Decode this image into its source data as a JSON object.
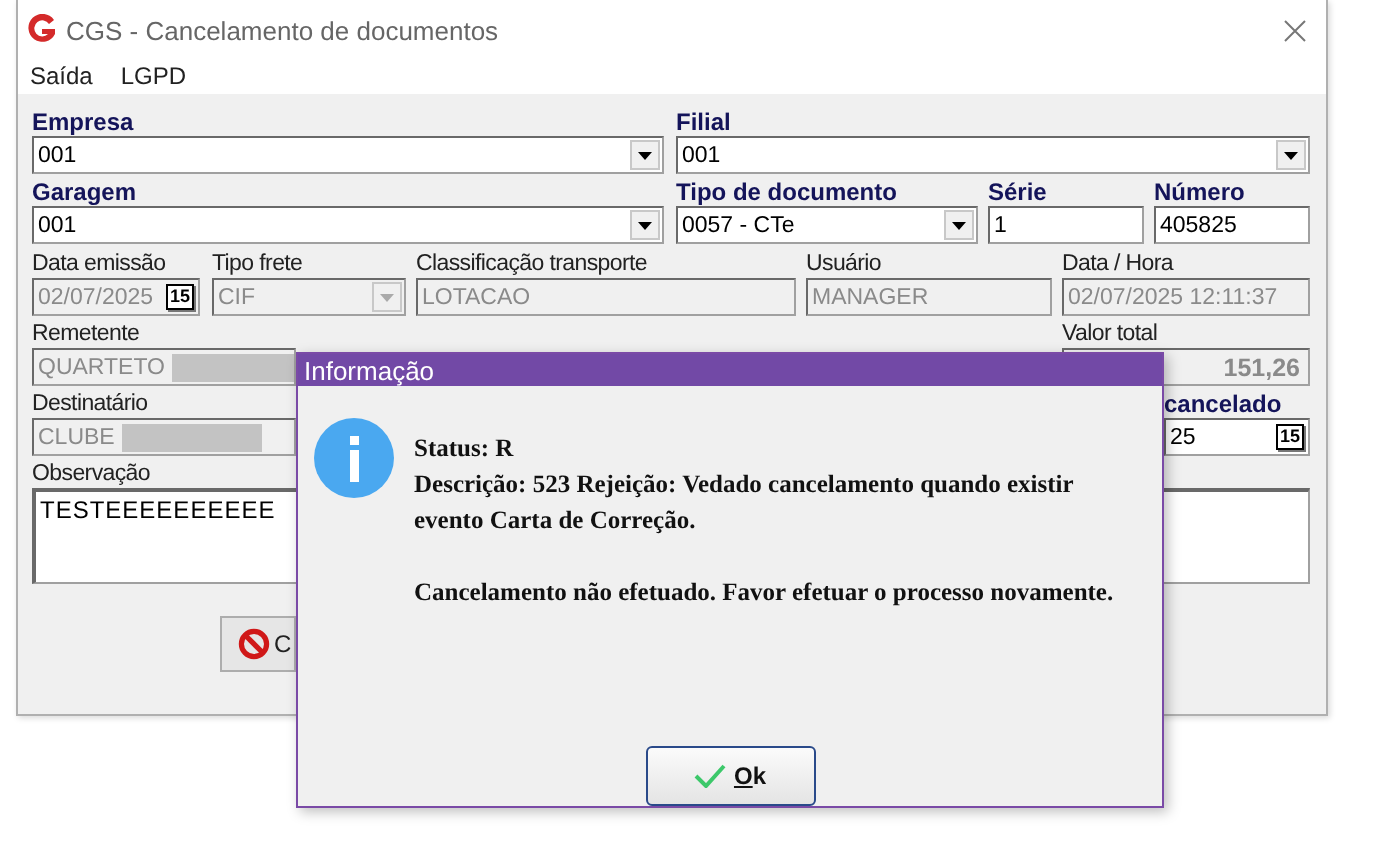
{
  "window": {
    "title": "CGS - Cancelamento de documentos"
  },
  "menu": [
    {
      "label": "Saída"
    },
    {
      "label": "LGPD"
    }
  ],
  "rows": [
    [
      {
        "label": "Empresa",
        "value": "001",
        "kind": "combo",
        "required": true,
        "disabled": false
      },
      {
        "label": "Filial",
        "value": "001",
        "kind": "combo",
        "required": true,
        "disabled": false
      }
    ],
    [
      {
        "label": "Garagem",
        "value": "001",
        "kind": "combo",
        "required": true,
        "disabled": false
      },
      {
        "label": "Tipo de documento",
        "value": "0057 - CTe",
        "kind": "combo",
        "required": true,
        "disabled": false
      },
      {
        "label": "Série",
        "value": "1",
        "kind": "text",
        "required": true,
        "disabled": false
      },
      {
        "label": "Número",
        "value": "405825",
        "kind": "text",
        "required": true,
        "disabled": false
      }
    ],
    [
      {
        "label": "Data emissão",
        "value": "02/07/2025",
        "kind": "date",
        "picker": "15",
        "required": false,
        "disabled": true
      },
      {
        "label": "Tipo frete",
        "value": "CIF",
        "kind": "combo",
        "required": false,
        "disabled": true
      },
      {
        "label": "Classificação transporte",
        "value": "LOTACAO",
        "kind": "text",
        "required": false,
        "disabled": true
      },
      {
        "label": "Usuário",
        "value": "MANAGER",
        "kind": "text",
        "required": false,
        "disabled": true
      },
      {
        "label": "Data / Hora",
        "value": "02/07/2025 12:11:37",
        "kind": "text",
        "required": false,
        "disabled": true
      }
    ],
    [
      {
        "label": "Remetente",
        "value": "QUARTETO",
        "kind": "text",
        "redacted": true,
        "required": false,
        "disabled": true
      },
      {
        "label": "Valor total",
        "value": "151,26",
        "kind": "amount",
        "required": false,
        "disabled": true
      }
    ],
    [
      {
        "label": "Destinatário",
        "value": "CLUBE",
        "kind": "text",
        "redacted": true,
        "required": false,
        "disabled": true
      },
      {
        "label": "cancelado",
        "value": "25",
        "kind": "date",
        "picker": "15",
        "required": true,
        "disabled": false
      }
    ],
    [
      {
        "label": "Observação",
        "value": "TESTEEEEEEEEEE",
        "kind": "memo",
        "required": false,
        "disabled": false
      }
    ]
  ],
  "buttons": [
    {
      "label": "C",
      "kind": "cancel"
    }
  ],
  "dialog": {
    "title": "Informação",
    "paragraphs": [
      {
        "lines": [
          "Status: R",
          "Descrição: 523 Rejeição: Vedado cancelamento quando existir evento Carta de Correção."
        ]
      },
      {
        "lines": [
          "Cancelamento não efetuado. Favor efetuar o processo novamente."
        ]
      }
    ],
    "button": {
      "label": "Ok",
      "kind": "confirm"
    }
  }
}
